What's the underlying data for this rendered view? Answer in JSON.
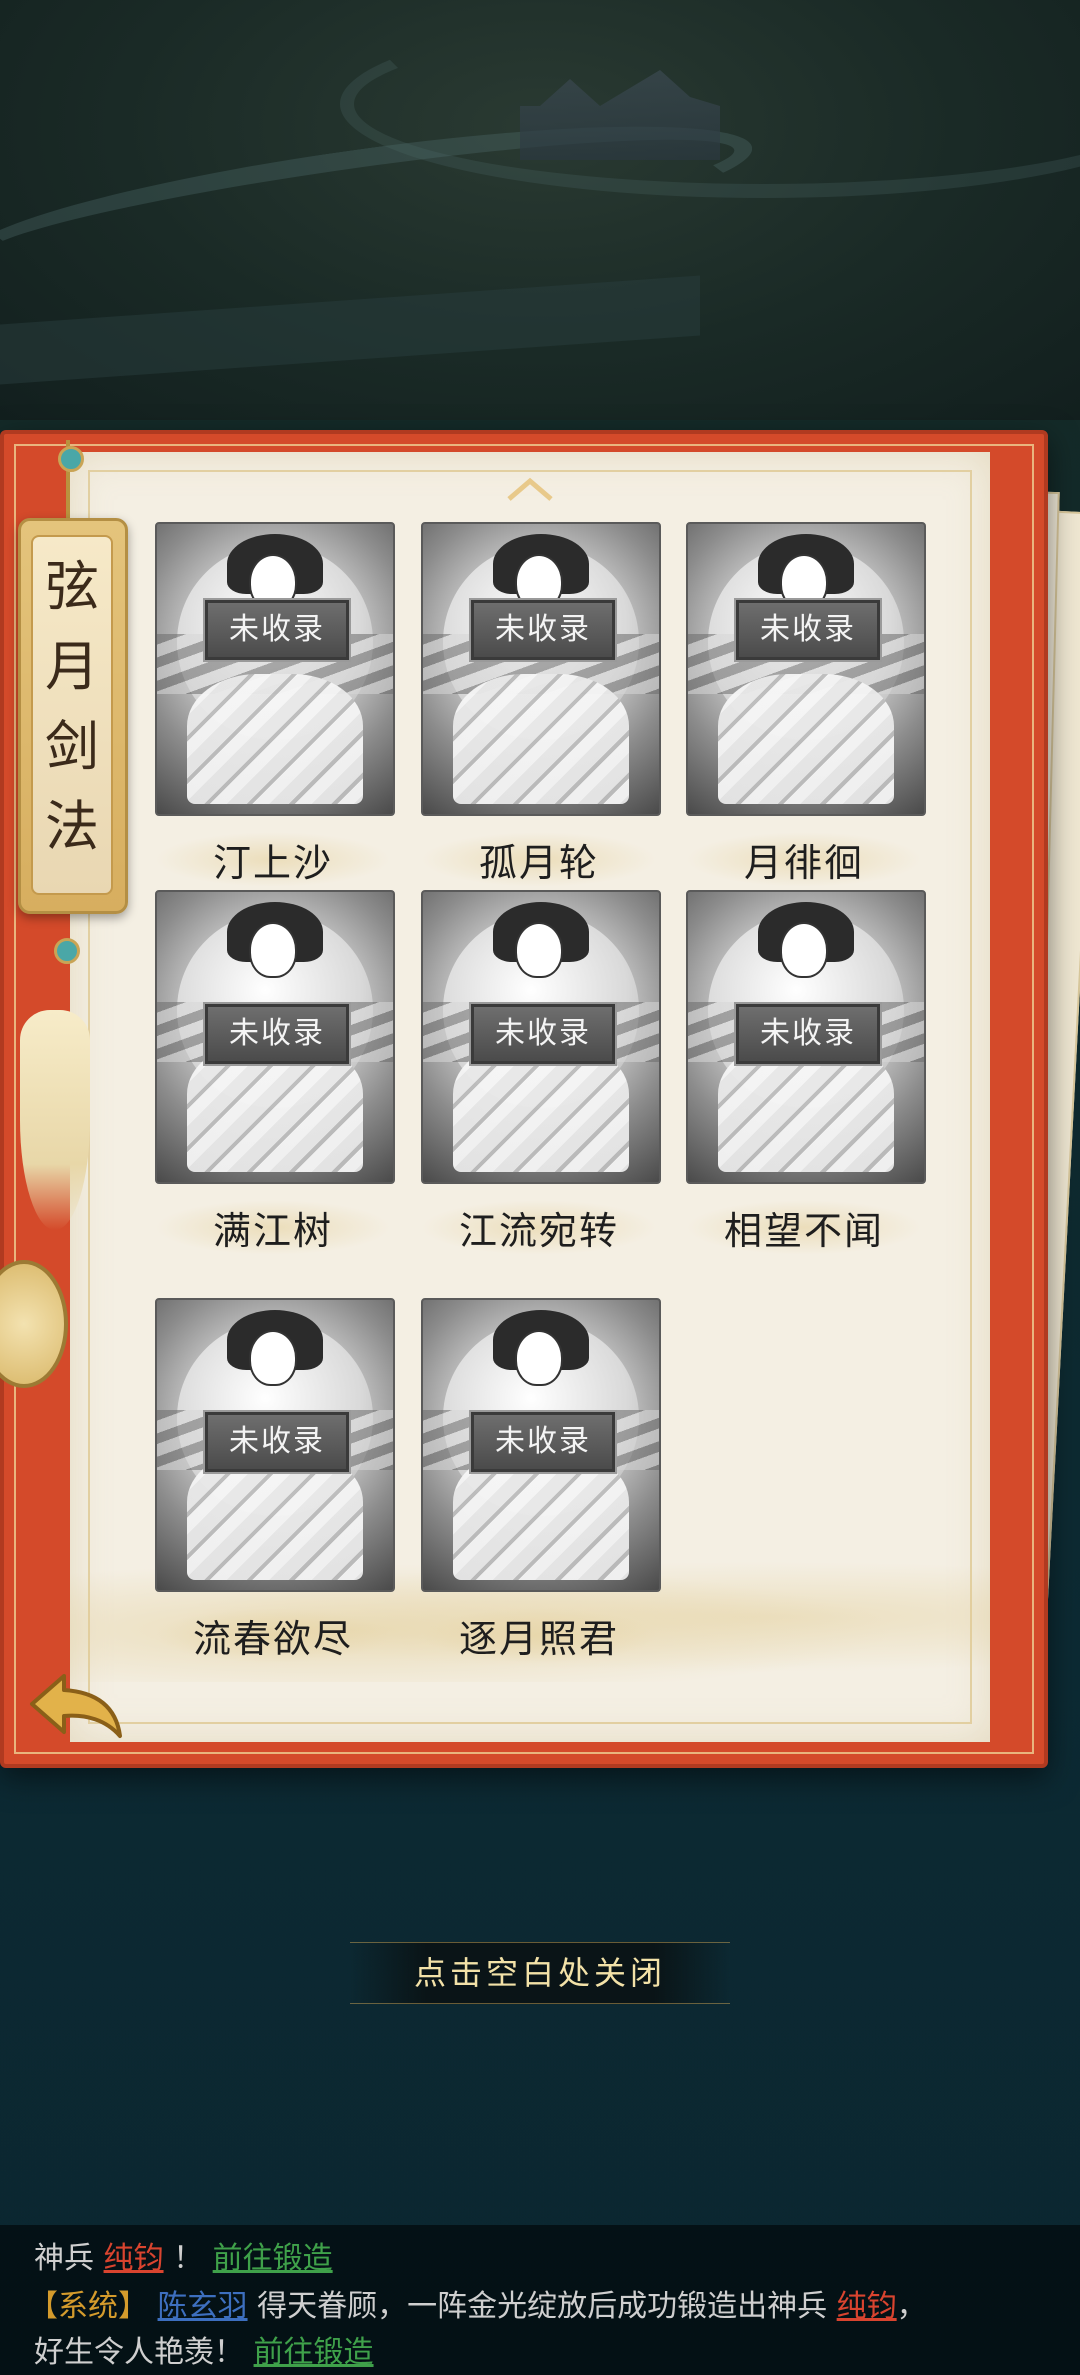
{
  "tag_title": "弦月剑法",
  "badge_text": "未收录",
  "items": [
    {
      "name": "汀上沙"
    },
    {
      "name": "孤月轮"
    },
    {
      "name": "月徘徊"
    },
    {
      "name": "满江树"
    },
    {
      "name": "江流宛转"
    },
    {
      "name": "相望不闻"
    },
    {
      "name": "流春欲尽"
    },
    {
      "name": "逐月照君"
    }
  ],
  "close_hint": "点击空白处关闭",
  "chat": {
    "line1": {
      "prefix": "神兵",
      "weapon": "纯钧",
      "sep": "！",
      "link": "前往锻造"
    },
    "line2": {
      "system": "【系统】",
      "player": "陈玄羽",
      "text": "得天眷顾，一阵金光绽放后成功锻造出神兵",
      "weapon": "纯钧",
      "end": "，"
    },
    "line3": {
      "text": "好生令人艳羡！",
      "link": "前往锻造"
    }
  }
}
